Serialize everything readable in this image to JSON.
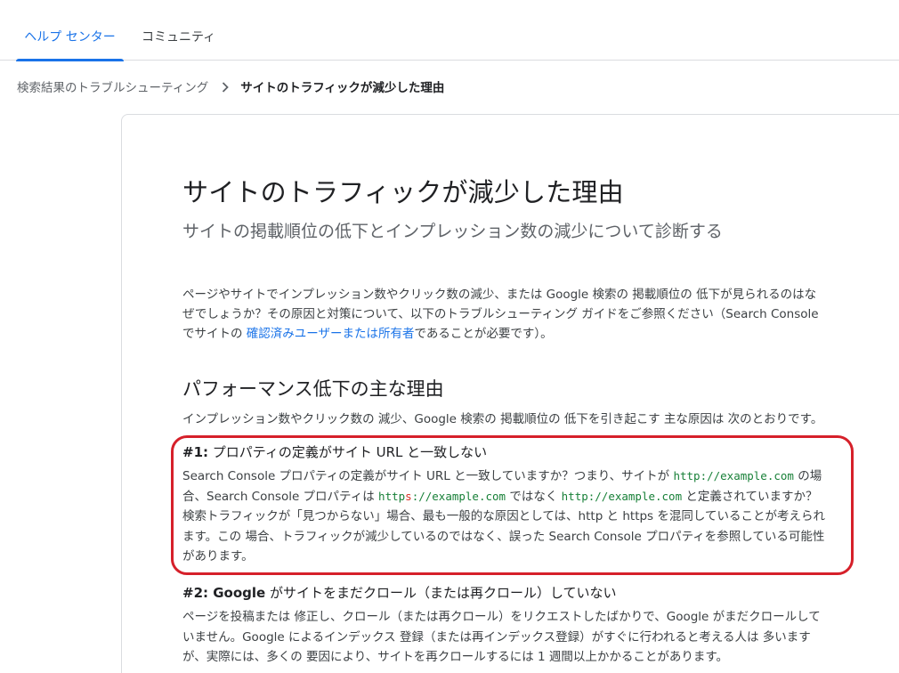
{
  "nav": {
    "tabs": [
      {
        "label": "ヘルプ センター"
      },
      {
        "label": "コミュニティ"
      }
    ]
  },
  "breadcrumb": {
    "parent": "検索結果のトラブルシューティング",
    "current": "サイトのトラフィックが減少した理由"
  },
  "article": {
    "title": "サイトのトラフィックが減少した理由",
    "subtitle": "サイトの掲載順位の低下とインプレッション数の減少について診断する",
    "intro_part1": "ページやサイトでインプレッション数やクリック数の減少、または Google 検索の 掲載順位の 低下が見られるのはなぜでしょうか？その原因と対策について、以下のトラブルシューティング ガイドをご参照ください（Search Console でサイトの ",
    "intro_link": "確認済みユーザーまたは所有者",
    "intro_part2": "であることが必要です）。",
    "section_heading": "パフォーマンス低下の主な理由",
    "section_desc": "インプレッション数やクリック数の 減少、Google 検索の 掲載順位の 低下を引き起こす 主な原因は 次のとおりです。",
    "reason1": {
      "num": "#1:",
      "title": " プロパティの定義がサイト URL と一致しない",
      "t1": "Search Console プロパティの定義がサイト URL と一致していますか？つまり、サイトが ",
      "c1": "http://example.com",
      "t2": " の場合、Search Console プロパティは ",
      "c2a": "http",
      "c2b": "s",
      "c2c": "://example.com",
      "t3": " ではなく ",
      "c3": "http://example.com",
      "t4": " と定義されていますか？ 検索トラフィックが「見つからない」場合、最も一般的な原因としては、http と https を混同していることが考えられます。この 場合、トラフィックが減少しているのではなく、誤った Search Console プロパティを参照している可能性があります。"
    },
    "reason2": {
      "num": "#2: Google",
      "title": " がサイトをまだクロール（または再クロール）していない",
      "body": "ページを投稿または 修正し、クロール（または再クロール）をリクエストしたばかりで、Google がまだクロールしていません。Google によるインデックス 登録（または再インデックス登録）がすぐに行われると考える人は 多いますが、実際には、多くの 要因により、サイトを再クロールするには 1 週間以上かかることがあります。"
    }
  }
}
